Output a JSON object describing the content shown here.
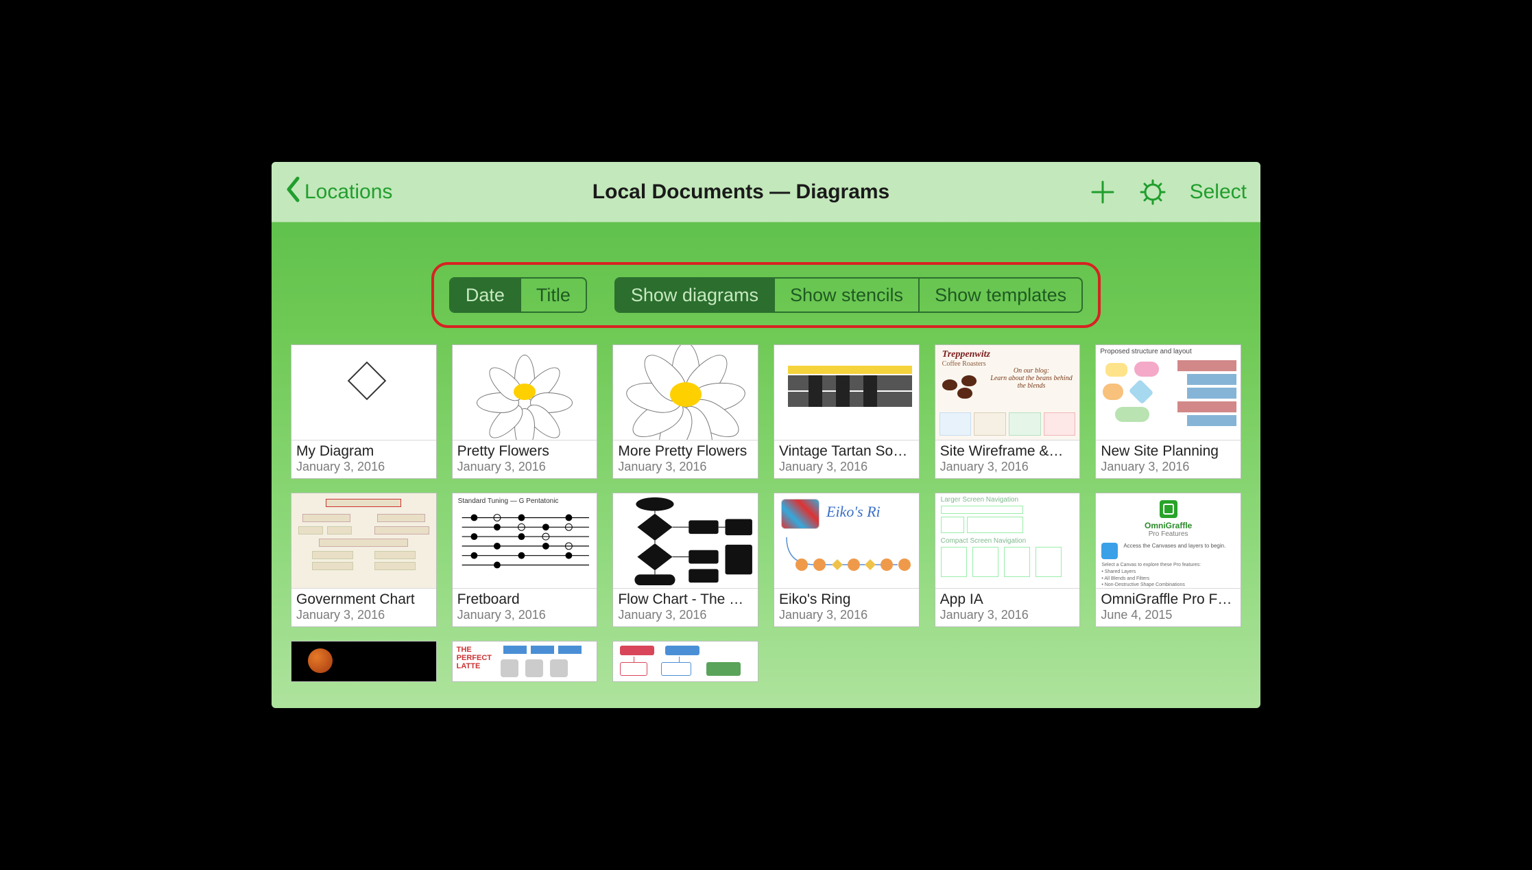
{
  "nav": {
    "back_label": "Locations",
    "title": "Local Documents — Diagrams",
    "select_label": "Select"
  },
  "segments": {
    "sort": [
      {
        "label": "Date",
        "selected": true
      },
      {
        "label": "Title",
        "selected": false
      }
    ],
    "filter": [
      {
        "label": "Show diagrams",
        "selected": true
      },
      {
        "label": "Show stencils",
        "selected": false
      },
      {
        "label": "Show templates",
        "selected": false
      }
    ]
  },
  "documents": [
    {
      "title": "My Diagram",
      "date": "January 3, 2016"
    },
    {
      "title": "Pretty Flowers",
      "date": "January 3, 2016"
    },
    {
      "title": "More Pretty Flowers",
      "date": "January 3, 2016"
    },
    {
      "title": "Vintage Tartan Soc…",
      "date": "January 3, 2016"
    },
    {
      "title": "Site Wireframe &…",
      "date": "January 3, 2016"
    },
    {
      "title": "New Site Planning",
      "date": "January 3, 2016"
    },
    {
      "title": "Government Chart",
      "date": "January 3, 2016"
    },
    {
      "title": "Fretboard",
      "date": "January 3, 2016"
    },
    {
      "title": "Flow Chart - The G…",
      "date": "January 3, 2016"
    },
    {
      "title": "Eiko's Ring",
      "date": "January 3, 2016"
    },
    {
      "title": "App IA",
      "date": "January 3, 2016"
    },
    {
      "title": "OmniGraffle Pro Fe…",
      "date": "June 4, 2015"
    },
    {
      "title": "",
      "date": ""
    },
    {
      "title": "",
      "date": ""
    },
    {
      "title": "",
      "date": ""
    }
  ]
}
